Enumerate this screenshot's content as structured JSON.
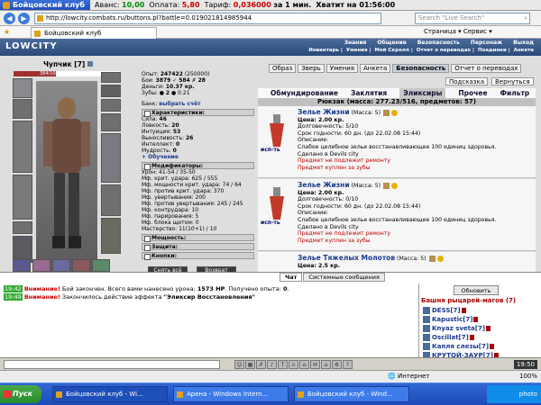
{
  "titlebar": {
    "title": "Бойцовский клуб",
    "avans_label": "Аванс:",
    "avans_val": "10,00",
    "oplata_label": "Оплата:",
    "oplata_val": "5,80",
    "tarif_label": "Тариф:",
    "tarif_val": "0,036000",
    "tarif_unit": "за 1 мин.",
    "enough": "Хватит на 01:56:00"
  },
  "address": {
    "url": "http://lowcity.combats.ru/buttons.pl?battle=0.019021814985944",
    "search_placeholder": "Search \"Live Search\""
  },
  "browser_tab": {
    "label": "Бойцовский клуб",
    "tools": "Страница ▾   Сервис ▾"
  },
  "header": {
    "logo": "LOWCITY",
    "menu": [
      "Знания",
      "Общение",
      "Безопасность",
      "Персонаж",
      "Выход"
    ],
    "menu2": [
      "Инвентарь",
      "Умения",
      "Мой Скролл",
      "Отчет о переводах",
      "Поединки",
      "Анкета"
    ]
  },
  "character": {
    "name": "Чупчик",
    "level": "[7]",
    "hp": "384/1049",
    "exp_label": "Опыт:",
    "exp": "247422",
    "exp_next": "(250000)",
    "fights_label": "Бои:",
    "fights": "3879",
    "wins": "584",
    "losses": "28",
    "money_label": "Деньги:",
    "money": "10.37 кр.",
    "teeth_label": "Зубы:",
    "teeth": "2",
    "teeth_sub": "0.21",
    "bank_label": "Банк:",
    "bank_link": "выбрать счёт"
  },
  "sections": {
    "char_title": "Характеристики:",
    "stats": [
      {
        "k": "Сила:",
        "v": "46"
      },
      {
        "k": "Ловкость:",
        "v": "20"
      },
      {
        "k": "Интуиция:",
        "v": "53"
      },
      {
        "k": "Выносливость:",
        "v": "26"
      },
      {
        "k": "Интеллект:",
        "v": "0"
      },
      {
        "k": "Мудрость:",
        "v": "0"
      }
    ],
    "training": "+ Обучение",
    "mod_title": "Модификаторы:",
    "mods": [
      {
        "k": "Урон:",
        "v": "41-54 / 35-50"
      },
      {
        "k": "Мф. крит. удара:",
        "v": "625 / 555"
      },
      {
        "k": "Мф. мощности крит. удара:",
        "v": "74 / 64"
      },
      {
        "k": "Мф. против крит. удара:",
        "v": "370"
      },
      {
        "k": "Мф. увертывания:",
        "v": "200"
      },
      {
        "k": "Мф. против увертывания:",
        "v": "245 / 245"
      },
      {
        "k": "Мф. контрудара:",
        "v": "10"
      },
      {
        "k": "Мф. парирования:",
        "v": "5"
      },
      {
        "k": "Мф. блока щитом:",
        "v": "0"
      },
      {
        "k": "Мастерство:",
        "v": "11(10+1) / 10"
      }
    ],
    "power_title": "Мощность:",
    "defense_title": "Защита:",
    "buttons_title": "Кнопки:",
    "btn_remove": "Снять всё",
    "btn_back": "Возврат"
  },
  "right_tabs": {
    "tabs": [
      "Образ",
      "Зверь",
      "Умения",
      "Анкета",
      "Безопасность",
      "Отчет о переводах"
    ],
    "sub": [
      "Подсказка",
      "Вернуться"
    ]
  },
  "categories": {
    "items": [
      "Обмундирование",
      "Заклятия",
      "Эликсиры",
      "Прочее",
      "Фильтр"
    ],
    "active": "Эликсиры"
  },
  "backpack": "Рюкзак (масса: 277.23/516, предметов: 57)",
  "items": [
    {
      "name": "Зелье Жизни",
      "mass": "(Масса: 5)",
      "price": "Цена: 2.00 кр.",
      "durability": "Долговечность: 5/10",
      "expiry": "Срок годности: 60 дн. (до 22.02.08 15:44)",
      "desc_label": "Описание:",
      "desc": "Слабое целебное зелье восстанавливающее 100 единиц здоровья.",
      "made": "Сделано в Devils city",
      "warn1": "Предмет не подлежит ремонту",
      "warn2": "Предмет куплен за зубы",
      "use": "исп-ть"
    },
    {
      "name": "Зелье Жизни",
      "mass": "(Масса: 5)",
      "price": "Цена: 2.00 кр.",
      "durability": "Долговечность: 0/10",
      "expiry": "Срок годности: 60 дн. (до 22.02.08 15:44)",
      "desc_label": "Описание:",
      "desc": "Слабое целебное зелье восстанавливающее 100 единиц здоровья.",
      "made": "Сделано в Devils city",
      "warn1": "Предмет не подлежит ремонту",
      "warn2": "Предмет куплен за зубы",
      "use": "исп-ть"
    },
    {
      "name": "Зелье Тяжелых Молотов",
      "mass": "(Масса: 5)",
      "price": "Цена: 2.5 кр."
    }
  ],
  "chat": {
    "tabs": [
      "Чат",
      "Системные сообщения"
    ],
    "lines": [
      {
        "time": "19:42",
        "warn": "Внимание!",
        "text": "Бой закончен. Всего вами нанесено урона:",
        "hp": "1573 HP",
        "text2": ". Получено опыта:",
        "exp": "0",
        "end": "."
      },
      {
        "time": "19:49",
        "warn": "Внимание!",
        "text": "Закончилось действие эффекта",
        "effect": "\"Эликсир Восстановления\""
      }
    ]
  },
  "room": {
    "refresh": "Обновить",
    "name": "Башня рыцарей-магов (7)",
    "players": [
      "DESS[7]",
      "Kapustic[7]",
      "Knyaz sveta[7]",
      "Oscillat[7]",
      "Капля слезы[7]",
      "КРУТОЙ-ЗАУР[7]"
    ]
  },
  "chat_clock": "19:50",
  "status": {
    "internet": "Интернет",
    "zoom": "100%"
  },
  "taskbar": {
    "start": "Пуск",
    "items": [
      "Бойцовский клуб - Wi...",
      "Арена - Windows Intern...",
      "Бойцовский клуб - Wind..."
    ],
    "watermark": "photo"
  }
}
